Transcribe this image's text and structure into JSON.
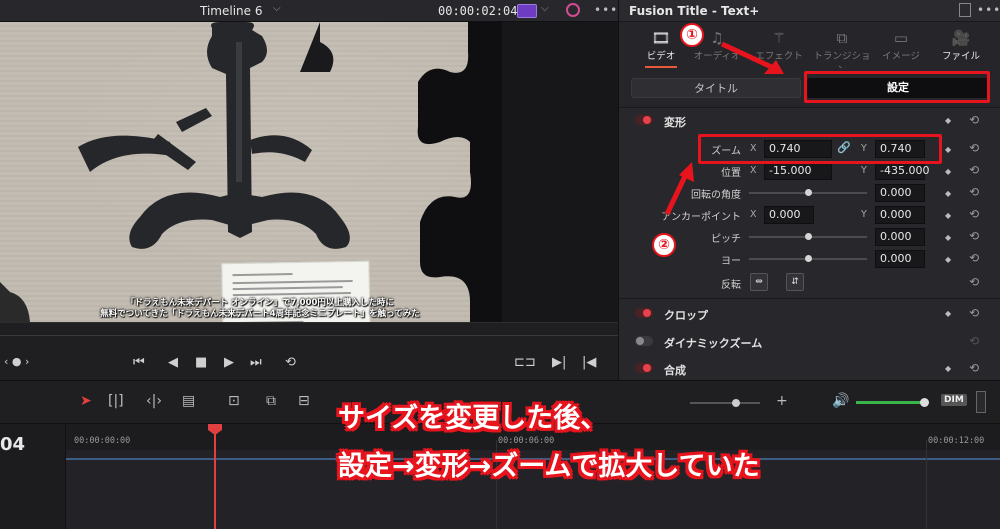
{
  "viewer": {
    "timeline_name": "Timeline 6",
    "timecode": "00:00:02:04",
    "subtitle_line1": "「ドラえもん未来デパート オンライン」で7,000円以上購入した時に",
    "subtitle_line2": "無料でついてきた「ドラえもん未来デパート4周年記念ミニプレート」を触ってみた"
  },
  "inspector": {
    "title": "Fusion Title - Text+",
    "tabs": [
      {
        "label": "ビデオ",
        "icon": "film-icon"
      },
      {
        "label": "オーディオ",
        "icon": "music-icon"
      },
      {
        "label": "エフェクト",
        "icon": "wand-icon"
      },
      {
        "label": "トランジション",
        "icon": "transition-icon"
      },
      {
        "label": "イメージ",
        "icon": "image-icon"
      },
      {
        "label": "ファイル",
        "icon": "camera-icon"
      }
    ],
    "subtabs": {
      "title": "タイトル",
      "settings": "設定"
    },
    "sections": {
      "transform": "変形",
      "crop": "クロップ",
      "dynamic_zoom": "ダイナミックズーム",
      "composite": "合成"
    },
    "params": {
      "zoom": {
        "label": "ズーム",
        "x_axis": "X",
        "x": "0.740",
        "y_axis": "Y",
        "y": "0.740"
      },
      "position": {
        "label": "位置",
        "x_axis": "X",
        "x": "-15.000",
        "y_axis": "Y",
        "y": "-435.000"
      },
      "rotation": {
        "label": "回転の角度",
        "value": "0.000",
        "slider": 0.5
      },
      "anchor": {
        "label": "アンカーポイント",
        "x_axis": "X",
        "x": "0.000",
        "y_axis": "Y",
        "y": "0.000"
      },
      "pitch": {
        "label": "ピッチ",
        "value": "0.000",
        "slider": 0.5
      },
      "yaw": {
        "label": "ヨー",
        "value": "0.000",
        "slider": 0.5
      },
      "flip": {
        "label": "反転"
      }
    }
  },
  "timeline": {
    "track_number": "04",
    "ruler": [
      "00:00:00:00",
      "00:00:06:00",
      "00:00:12:00"
    ],
    "dim_label": "DIM"
  },
  "annotations": {
    "step1": "①",
    "step2": "②",
    "caption_line1": "サイズを変更した後、",
    "caption_line2": "設定→変形→ズームで拡大していた"
  },
  "colors": {
    "accent_red": "#e8141d",
    "keyframe_on": "#e8414b",
    "volume_green": "#3bb54a"
  }
}
